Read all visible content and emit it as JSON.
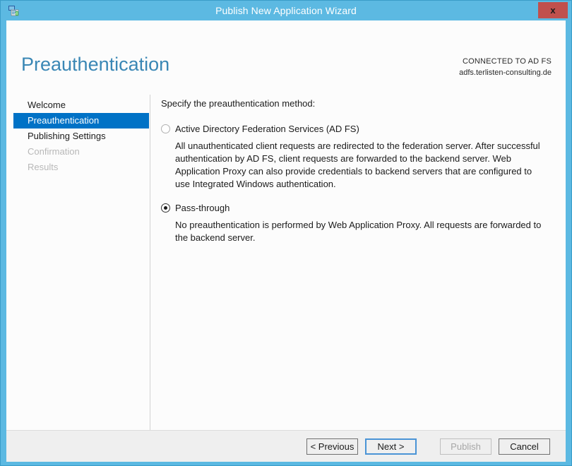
{
  "window": {
    "title": "Publish New Application Wizard",
    "app_icon": "application-publish-icon",
    "close_label": "x",
    "border_color": "#5cb9e2",
    "titlebar_color": "#5cb9e2",
    "close_button_color": "#c0504d"
  },
  "header": {
    "page_title": "Preauthentication",
    "page_title_color": "#3a87b5",
    "connected_label": "CONNECTED TO AD FS",
    "connected_host": "adfs.terlisten-consulting.de"
  },
  "sidebar": {
    "accent_color": "#0072c6",
    "items": [
      {
        "label": "Welcome",
        "state": "normal"
      },
      {
        "label": "Preauthentication",
        "state": "active"
      },
      {
        "label": "Publishing Settings",
        "state": "normal"
      },
      {
        "label": "Confirmation",
        "state": "disabled"
      },
      {
        "label": "Results",
        "state": "disabled"
      }
    ]
  },
  "main": {
    "instruction": "Specify the preauthentication method:",
    "options": [
      {
        "label": "Active Directory Federation Services (AD FS)",
        "selected": false,
        "description": "All unauthenticated client requests are redirected to the federation server. After successful authentication by AD FS, client requests are forwarded to the backend server. Web Application Proxy can also provide credentials to backend servers that are configured to use Integrated Windows authentication."
      },
      {
        "label": "Pass-through",
        "selected": true,
        "description": "No preauthentication is performed by Web Application Proxy. All requests are forwarded to the backend server."
      }
    ]
  },
  "footer": {
    "buttons": [
      {
        "label": "< Previous",
        "state": "normal"
      },
      {
        "label": "Next >",
        "state": "default"
      },
      {
        "label": "Publish",
        "state": "disabled"
      },
      {
        "label": "Cancel",
        "state": "normal"
      }
    ]
  }
}
